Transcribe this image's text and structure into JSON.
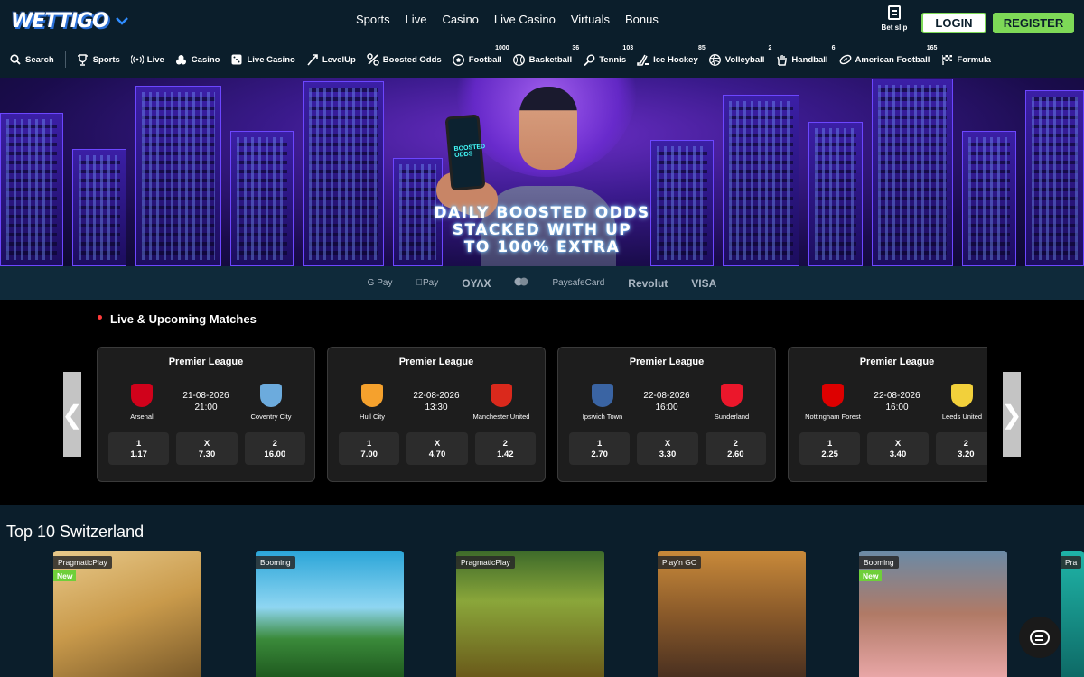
{
  "header": {
    "logo": "WETTIGO",
    "nav": [
      "Sports",
      "Live",
      "Casino",
      "Live Casino",
      "Virtuals",
      "Bonus"
    ],
    "betslip_label": "Bet slip",
    "login_label": "LOGIN",
    "register_label": "REGISTER"
  },
  "categories": [
    {
      "label": "Search",
      "icon": "search-icon",
      "count": ""
    },
    {
      "label": "Sports",
      "icon": "trophy-icon",
      "count": ""
    },
    {
      "label": "Live",
      "icon": "live-icon",
      "count": ""
    },
    {
      "label": "Casino",
      "icon": "casino-icon",
      "count": ""
    },
    {
      "label": "Live Casino",
      "icon": "dice-icon",
      "count": ""
    },
    {
      "label": "LevelUp",
      "icon": "levelup-icon",
      "count": ""
    },
    {
      "label": "Boosted Odds",
      "icon": "percent-icon",
      "count": ""
    },
    {
      "label": "Football",
      "icon": "football-icon",
      "count": "1000"
    },
    {
      "label": "Basketball",
      "icon": "basketball-icon",
      "count": "36"
    },
    {
      "label": "Tennis",
      "icon": "tennis-icon",
      "count": "103"
    },
    {
      "label": "Ice Hockey",
      "icon": "hockey-icon",
      "count": "85"
    },
    {
      "label": "Volleyball",
      "icon": "volleyball-icon",
      "count": "2"
    },
    {
      "label": "Handball",
      "icon": "handball-icon",
      "count": "6"
    },
    {
      "label": "American Football",
      "icon": "american-football-icon",
      "count": "165"
    },
    {
      "label": "Formula",
      "icon": "flag-icon",
      "count": ""
    }
  ],
  "banner": {
    "line1": "DAILY BOOSTED ODDS",
    "line2": "STACKED WITH UP",
    "line3": "TO 100% EXTRA",
    "phone_text": "BOOSTED ODDS"
  },
  "payments": [
    "G Pay",
    "Pay",
    "ОΥΛΧ",
    "",
    "PaysafeCard",
    "Revolut",
    "VISA"
  ],
  "matches": {
    "title": "Live & Upcoming Matches",
    "items": [
      {
        "league": "Premier League",
        "home": "Arsenal",
        "away": "Coventry City",
        "date": "21-08-2026",
        "time": "21:00",
        "home_color": "#d0021b",
        "away_color": "#6cabdd",
        "odds": [
          {
            "label": "1",
            "value": "1.17"
          },
          {
            "label": "X",
            "value": "7.30"
          },
          {
            "label": "2",
            "value": "16.00"
          }
        ]
      },
      {
        "league": "Premier League",
        "home": "Hull City",
        "away": "Manchester United",
        "date": "22-08-2026",
        "time": "13:30",
        "home_color": "#f5a12d",
        "away_color": "#da291c",
        "odds": [
          {
            "label": "1",
            "value": "7.00"
          },
          {
            "label": "X",
            "value": "4.70"
          },
          {
            "label": "2",
            "value": "1.42"
          }
        ]
      },
      {
        "league": "Premier League",
        "home": "Ipswich Town",
        "away": "Sunderland",
        "date": "22-08-2026",
        "time": "16:00",
        "home_color": "#3a64a3",
        "away_color": "#eb172b",
        "odds": [
          {
            "label": "1",
            "value": "2.70"
          },
          {
            "label": "X",
            "value": "3.30"
          },
          {
            "label": "2",
            "value": "2.60"
          }
        ]
      },
      {
        "league": "Premier League",
        "home": "Nottingham Forest",
        "away": "Leeds United",
        "date": "22-08-2026",
        "time": "16:00",
        "home_color": "#dd0000",
        "away_color": "#f2d03b",
        "odds": [
          {
            "label": "1",
            "value": "2.25"
          },
          {
            "label": "X",
            "value": "3.40"
          },
          {
            "label": "2",
            "value": "3.20"
          }
        ]
      }
    ]
  },
  "top10": {
    "title": "Top 10 Switzerland",
    "games": [
      {
        "provider": "PragmaticPlay",
        "new": "New",
        "bg": "#c99a4b"
      },
      {
        "provider": "Booming",
        "new": "",
        "bg": "#2aa5d8"
      },
      {
        "provider": "PragmaticPlay",
        "new": "",
        "bg": "#3d6a2a"
      },
      {
        "provider": "Play'n GO",
        "new": "",
        "bg": "#8a5a2a"
      },
      {
        "provider": "Booming",
        "new": "New",
        "bg": "#b07a66"
      },
      {
        "provider": "Pra",
        "new": "",
        "bg": "#1fb5a8"
      }
    ]
  }
}
